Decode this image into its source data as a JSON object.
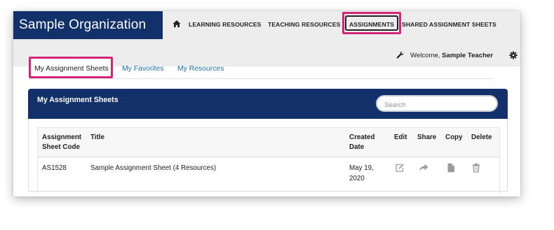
{
  "header": {
    "org_name": "Sample Organization",
    "nav": [
      {
        "label": "LEARNING RESOURCES"
      },
      {
        "label": "TEACHING RESOURCES"
      },
      {
        "label": "ASSIGNMENTS",
        "active": true
      },
      {
        "label": "SHARED ASSIGNMENT SHEETS"
      }
    ],
    "welcome_prefix": "Welcome, ",
    "user_name": "Sample Teacher",
    "brand_color": "#12306a",
    "highlight_color": "#d3257a"
  },
  "tabs": [
    {
      "label": "My Assignment Sheets",
      "active": true
    },
    {
      "label": "My Favorites"
    },
    {
      "label": "My Resources"
    }
  ],
  "panel": {
    "title": "My Assignment Sheets",
    "search_placeholder": "Search"
  },
  "table": {
    "columns": [
      {
        "label": "Assignment\nSheet Code"
      },
      {
        "label": "Title"
      },
      {
        "label": "Created\nDate"
      },
      {
        "label": "Edit"
      },
      {
        "label": "Share"
      },
      {
        "label": "Copy"
      },
      {
        "label": "Delete"
      }
    ],
    "rows": [
      {
        "code": "AS1528",
        "title": "Sample Assignment Sheet (4 Resources)",
        "created": "May 19,\n2020",
        "icons": [
          "edit-icon",
          "share-icon",
          "copy-icon",
          "delete-icon"
        ]
      }
    ]
  }
}
